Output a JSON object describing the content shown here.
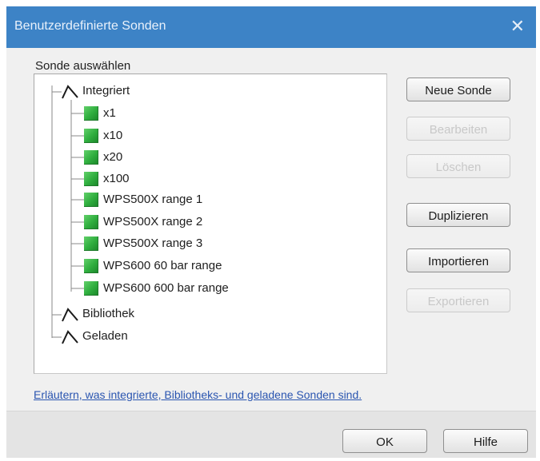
{
  "window": {
    "title": "Benutzerdefinierte Sonden",
    "close_glyph": "✕"
  },
  "tree": {
    "label": "Sonde auswählen",
    "groups": [
      {
        "label": "Integriert",
        "icon": "probe-folder-icon",
        "expanded": true,
        "items": [
          "x1",
          "x10",
          "x20",
          "x100",
          "WPS500X range 1",
          "WPS500X range 2",
          "WPS500X range 3",
          "WPS600 60 bar range",
          "WPS600 600 bar range"
        ]
      },
      {
        "label": "Bibliothek",
        "icon": "probe-folder-icon",
        "expanded": false
      },
      {
        "label": "Geladen",
        "icon": "probe-folder-icon",
        "expanded": false
      }
    ],
    "item_icon": "probe-green-icon"
  },
  "buttons": {
    "new_probe": "Neue Sonde",
    "edit": "Bearbeiten",
    "delete": "Löschen",
    "duplicate": "Duplizieren",
    "import": "Importieren",
    "export": "Exportieren"
  },
  "help_link": "Erläutern, was integrierte, Bibliotheks- und geladene Sonden sind.",
  "footer": {
    "ok": "OK",
    "help": "Hilfe"
  },
  "colors": {
    "titlebar": "#3d83c6",
    "link": "#2a55b0",
    "probe_green": "#2fae3e"
  }
}
